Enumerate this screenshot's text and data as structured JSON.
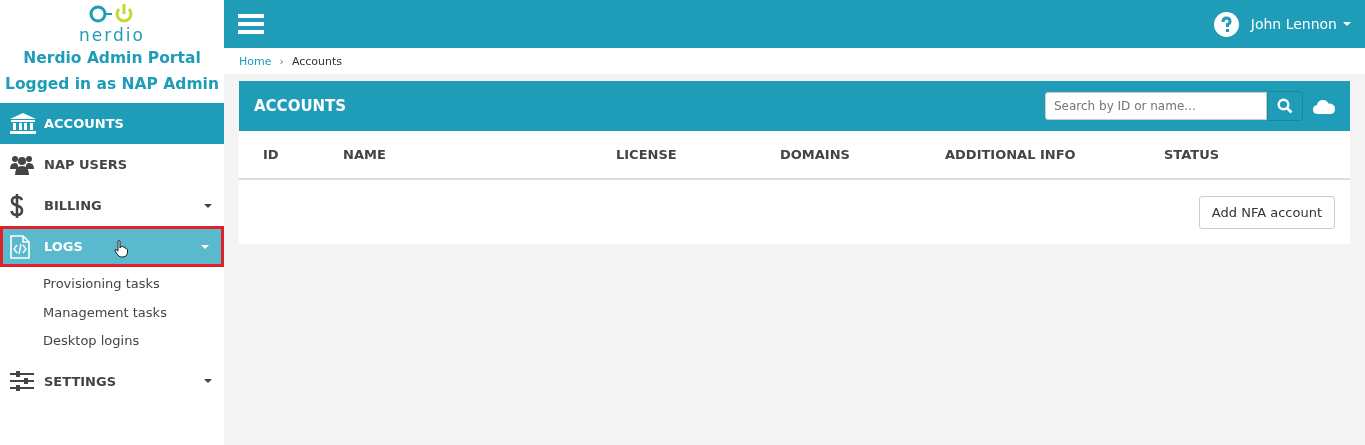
{
  "logo": {
    "text": "nerdio"
  },
  "sidebar": {
    "title": "Nerdio Admin Portal",
    "subtitle": "Logged in as NAP Admin",
    "items": [
      {
        "label": "ACCOUNTS",
        "selected": true,
        "highlighted": false,
        "has_caret": false
      },
      {
        "label": "NAP USERS",
        "selected": false,
        "highlighted": false,
        "has_caret": false
      },
      {
        "label": "BILLING",
        "selected": false,
        "highlighted": false,
        "has_caret": true
      },
      {
        "label": "LOGS",
        "selected": false,
        "highlighted": true,
        "has_caret": true,
        "children": [
          {
            "label": "Provisioning tasks"
          },
          {
            "label": "Management tasks"
          },
          {
            "label": "Desktop logins"
          }
        ]
      },
      {
        "label": "SETTINGS",
        "selected": false,
        "highlighted": false,
        "has_caret": true
      }
    ]
  },
  "topbar": {
    "user": "John Lennon"
  },
  "breadcrumb": {
    "separator": "›",
    "items": [
      "Home",
      "Accounts"
    ]
  },
  "panel": {
    "title": "ACCOUNTS",
    "search": {
      "placeholder": "Search by ID or name..."
    },
    "columns": [
      "ID",
      "NAME",
      "LICENSE",
      "DOMAINS",
      "ADDITIONAL INFO",
      "STATUS"
    ],
    "button": "Add NFA account"
  }
}
